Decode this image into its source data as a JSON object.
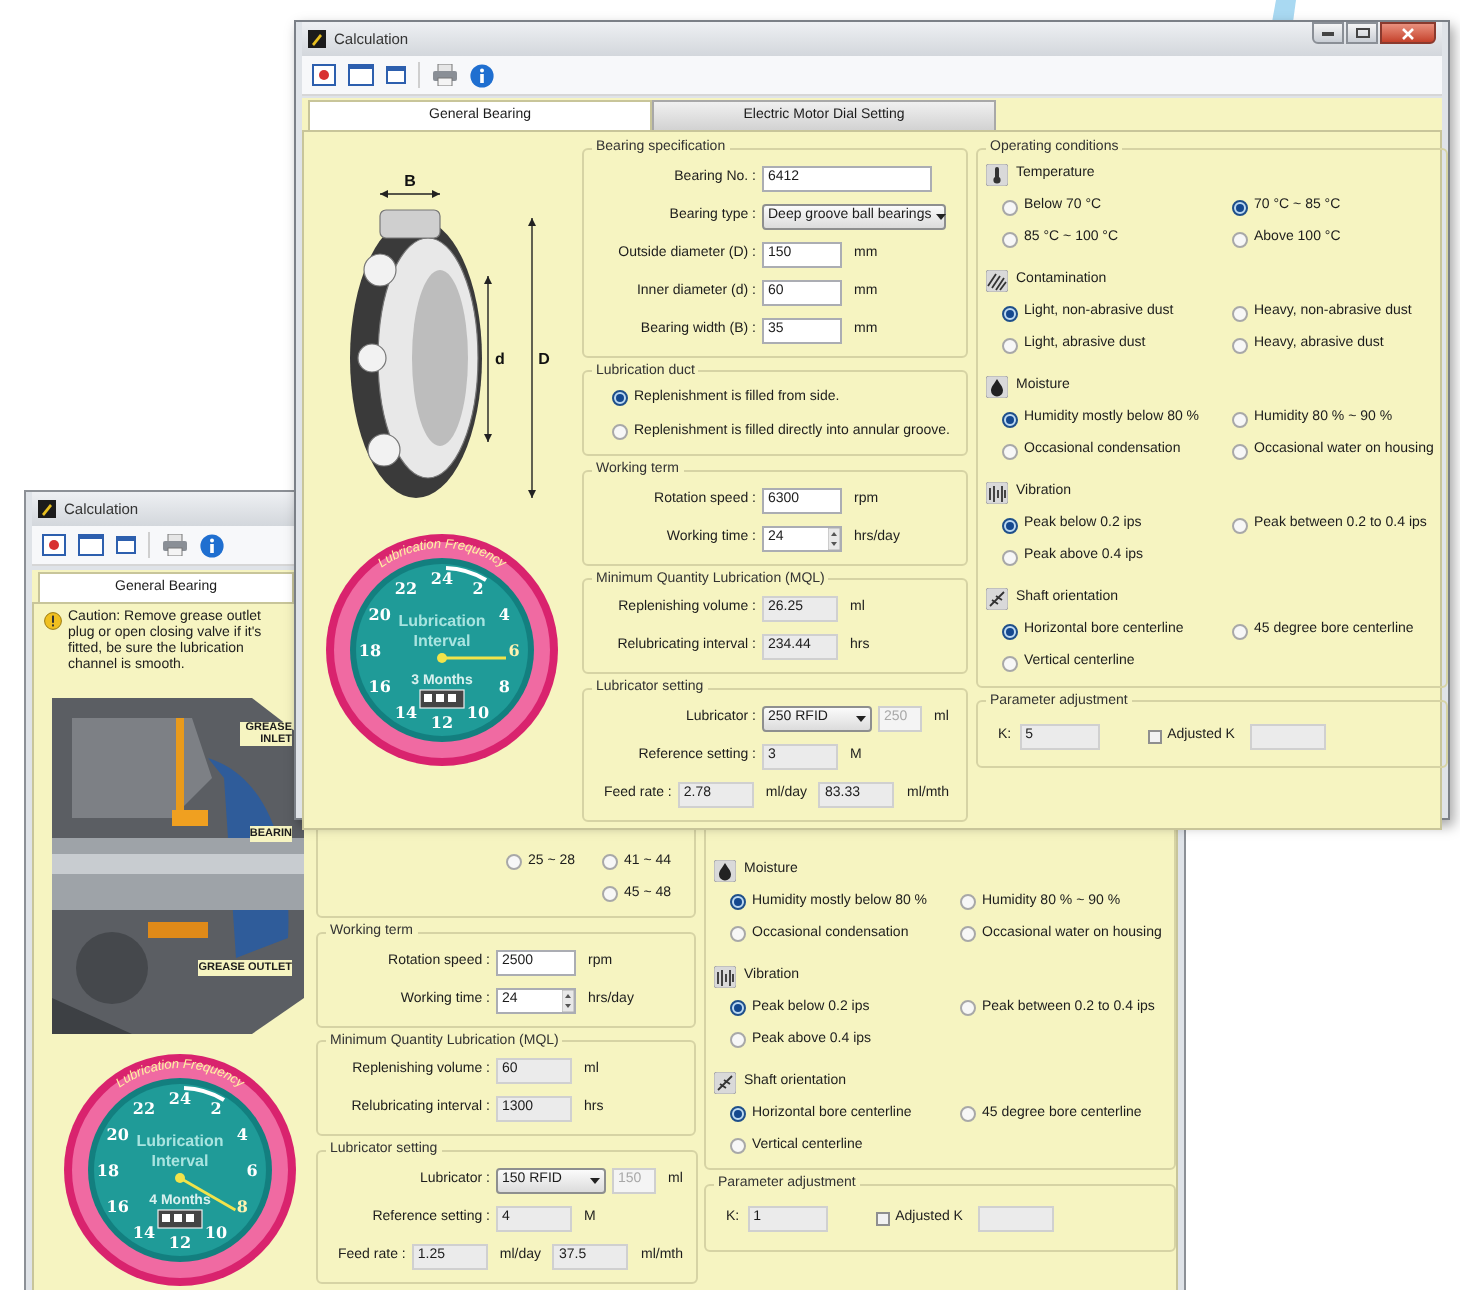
{
  "back_window": {
    "title": "Calculation",
    "tabs": [
      {
        "label": "General Bearing",
        "selected": true
      }
    ],
    "caution": "Caution: Remove grease outlet plug or open closing valve if it's fitted, be sure the lubrication channel is smooth.",
    "picture_labels": [
      "GREASE INLET",
      "BEARIN",
      "GREASE OUTLET"
    ],
    "gauge": {
      "title": "Lubrication Frequency",
      "numbers": [
        {
          "label": "2",
          "selected": false
        },
        {
          "label": "4",
          "selected": false
        },
        {
          "label": "6",
          "selected": false
        },
        {
          "label": "8",
          "selected": true
        },
        {
          "label": "10",
          "selected": false
        },
        {
          "label": "12",
          "selected": false
        },
        {
          "label": "14",
          "selected": false
        },
        {
          "label": "16",
          "selected": false
        },
        {
          "label": "18",
          "selected": false
        },
        {
          "label": "20",
          "selected": false
        },
        {
          "label": "22",
          "selected": false
        },
        {
          "label": "24",
          "selected": false
        }
      ],
      "label_lines": [
        "Lubrication",
        "Interval"
      ],
      "period": "4 Months"
    },
    "range_options": [
      [
        {
          "label": "25 ~ 28",
          "selected": false
        },
        {
          "label": "41 ~ 44",
          "selected": false
        }
      ],
      [
        {
          "label": "45 ~ 48",
          "selected": false
        }
      ]
    ],
    "groups": [
      {
        "title": "Working term",
        "rows": [
          {
            "label": "Rotation speed :",
            "parts": [
              {
                "kind": "number",
                "value": "2500"
              },
              {
                "kind": "unit",
                "value": "rpm"
              }
            ]
          },
          {
            "label": "Working time :",
            "parts": [
              {
                "kind": "spin",
                "value": "24"
              },
              {
                "kind": "unit",
                "value": "hrs/day"
              }
            ]
          }
        ]
      },
      {
        "title": "Minimum Quantity Lubrication (MQL)",
        "rows": [
          {
            "label": "Replenishing volume :",
            "parts": [
              {
                "kind": "readonly",
                "value": "60"
              },
              {
                "kind": "unit",
                "value": "ml"
              }
            ]
          },
          {
            "label": "Relubricating interval :",
            "parts": [
              {
                "kind": "readonly",
                "value": "1300"
              },
              {
                "kind": "unit",
                "value": "hrs"
              }
            ]
          }
        ]
      },
      {
        "title": "Lubricator setting",
        "rows": [
          {
            "label": "Lubricator :",
            "parts": [
              {
                "kind": "select",
                "value": "150 RFID"
              },
              {
                "kind": "disabled",
                "value": "150"
              },
              {
                "kind": "unit",
                "value": "ml"
              }
            ]
          },
          {
            "label": "Reference setting :",
            "parts": [
              {
                "kind": "readonly",
                "value": "4"
              },
              {
                "kind": "unit",
                "value": "M"
              }
            ]
          },
          {
            "label": "Feed rate :",
            "parts": [
              {
                "kind": "readonly",
                "value": "1.25"
              },
              {
                "kind": "unit",
                "value": "ml/day"
              },
              {
                "kind": "readonly",
                "value": "37.5"
              },
              {
                "kind": "unit",
                "value": "ml/mth"
              }
            ]
          }
        ]
      }
    ],
    "operating_conditions": {
      "categories": [
        {
          "kind": "moisture",
          "name": "Moisture",
          "options": [
            {
              "label": "Humidity mostly below 80 %",
              "selected": true
            },
            {
              "label": "Humidity 80 % ~ 90 %",
              "selected": false
            },
            {
              "label": "Occasional condensation",
              "selected": false
            },
            {
              "label": "Occasional water on housing",
              "selected": false
            }
          ]
        },
        {
          "kind": "vibration",
          "name": "Vibration",
          "options": [
            {
              "label": "Peak below 0.2 ips",
              "selected": true
            },
            {
              "label": "Peak between 0.2 to 0.4 ips",
              "selected": false
            },
            {
              "label": "Peak above 0.4 ips",
              "selected": false
            }
          ]
        },
        {
          "kind": "shaft",
          "name": "Shaft orientation",
          "options": [
            {
              "label": "Horizontal bore centerline",
              "selected": true
            },
            {
              "label": "45 degree bore centerline",
              "selected": false
            },
            {
              "label": "Vertical centerline",
              "selected": false
            }
          ]
        }
      ]
    },
    "parameter_adjustment": {
      "title": "Parameter adjustment",
      "k_label": "K:",
      "k_value": "1",
      "adjusted_label": "Adjusted K",
      "adjusted_checked": false
    }
  },
  "front_window": {
    "title": "Calculation",
    "tabs": [
      {
        "label": "General Bearing",
        "selected": true
      },
      {
        "label": "Electric Motor Dial Setting",
        "selected": false
      }
    ],
    "bearing_labels": [
      "B",
      "d",
      "D"
    ],
    "gauge": {
      "title": "Lubrication Frequency",
      "numbers": [
        {
          "label": "2",
          "selected": false
        },
        {
          "label": "4",
          "selected": false
        },
        {
          "label": "6",
          "selected": true
        },
        {
          "label": "8",
          "selected": false
        },
        {
          "label": "10",
          "selected": false
        },
        {
          "label": "12",
          "selected": false
        },
        {
          "label": "14",
          "selected": false
        },
        {
          "label": "16",
          "selected": false
        },
        {
          "label": "18",
          "selected": false
        },
        {
          "label": "20",
          "selected": false
        },
        {
          "label": "22",
          "selected": false
        },
        {
          "label": "24",
          "selected": false
        }
      ],
      "label_lines": [
        "Lubrication",
        "Interval"
      ],
      "period": "3 Months"
    },
    "groups": [
      {
        "title": "Bearing specification",
        "rows": [
          {
            "label": "Bearing No. :",
            "parts": [
              {
                "kind": "text",
                "value": "6412"
              }
            ]
          },
          {
            "label": "Bearing type :",
            "parts": [
              {
                "kind": "select",
                "value": "Deep groove ball bearings"
              }
            ]
          },
          {
            "label": "Outside diameter (D) :",
            "parts": [
              {
                "kind": "number",
                "value": "150"
              },
              {
                "kind": "unit",
                "value": "mm"
              }
            ]
          },
          {
            "label": "Inner diameter (d) :",
            "parts": [
              {
                "kind": "number",
                "value": "60"
              },
              {
                "kind": "unit",
                "value": "mm"
              }
            ]
          },
          {
            "label": "Bearing width (B) :",
            "parts": [
              {
                "kind": "number",
                "value": "35"
              },
              {
                "kind": "unit",
                "value": "mm"
              }
            ]
          }
        ]
      },
      {
        "title": "Lubrication duct",
        "options": [
          {
            "label": "Replenishment is filled from side.",
            "selected": true
          },
          {
            "label": "Replenishment is filled directly into annular groove.",
            "selected": false
          }
        ]
      },
      {
        "title": "Working term",
        "rows": [
          {
            "label": "Rotation speed :",
            "parts": [
              {
                "kind": "number",
                "value": "6300"
              },
              {
                "kind": "unit",
                "value": "rpm"
              }
            ]
          },
          {
            "label": "Working time :",
            "parts": [
              {
                "kind": "spin",
                "value": "24"
              },
              {
                "kind": "unit",
                "value": "hrs/day"
              }
            ]
          }
        ]
      },
      {
        "title": "Minimum Quantity Lubrication (MQL)",
        "rows": [
          {
            "label": "Replenishing volume :",
            "parts": [
              {
                "kind": "readonly",
                "value": "26.25"
              },
              {
                "kind": "unit",
                "value": "ml"
              }
            ]
          },
          {
            "label": "Relubricating interval :",
            "parts": [
              {
                "kind": "readonly",
                "value": "234.44"
              },
              {
                "kind": "unit",
                "value": "hrs"
              }
            ]
          }
        ]
      },
      {
        "title": "Lubricator setting",
        "rows": [
          {
            "label": "Lubricator :",
            "parts": [
              {
                "kind": "select",
                "value": "250 RFID"
              },
              {
                "kind": "disabled",
                "value": "250"
              },
              {
                "kind": "unit",
                "value": "ml"
              }
            ]
          },
          {
            "label": "Reference setting :",
            "parts": [
              {
                "kind": "readonly",
                "value": "3"
              },
              {
                "kind": "unit",
                "value": "M"
              }
            ]
          },
          {
            "label": "Feed rate :",
            "parts": [
              {
                "kind": "readonly",
                "value": "2.78"
              },
              {
                "kind": "unit",
                "value": "ml/day"
              },
              {
                "kind": "readonly",
                "value": "83.33"
              },
              {
                "kind": "unit",
                "value": "ml/mth"
              }
            ]
          }
        ]
      }
    ],
    "operating_conditions": {
      "title": "Operating conditions",
      "categories": [
        {
          "kind": "temperature",
          "name": "Temperature",
          "options": [
            {
              "label": "Below 70 °C",
              "selected": false
            },
            {
              "label": "70 °C ~ 85 °C",
              "selected": true
            },
            {
              "label": "85 °C ~ 100 °C",
              "selected": false
            },
            {
              "label": "Above 100 °C",
              "selected": false
            }
          ]
        },
        {
          "kind": "contamination",
          "name": "Contamination",
          "options": [
            {
              "label": "Light, non-abrasive dust",
              "selected": true
            },
            {
              "label": "Heavy, non-abrasive dust",
              "selected": false
            },
            {
              "label": "Light, abrasive dust",
              "selected": false
            },
            {
              "label": "Heavy, abrasive dust",
              "selected": false
            }
          ]
        },
        {
          "kind": "moisture",
          "name": "Moisture",
          "options": [
            {
              "label": "Humidity mostly below 80 %",
              "selected": true
            },
            {
              "label": "Humidity 80 % ~ 90 %",
              "selected": false
            },
            {
              "label": "Occasional condensation",
              "selected": false
            },
            {
              "label": "Occasional water on housing",
              "selected": false
            }
          ]
        },
        {
          "kind": "vibration",
          "name": "Vibration",
          "options": [
            {
              "label": "Peak below 0.2 ips",
              "selected": true
            },
            {
              "label": "Peak between 0.2 to 0.4 ips",
              "selected": false
            },
            {
              "label": "Peak above 0.4 ips",
              "selected": false
            }
          ]
        },
        {
          "kind": "shaft",
          "name": "Shaft orientation",
          "options": [
            {
              "label": "Horizontal bore centerline",
              "selected": true
            },
            {
              "label": "45 degree bore centerline",
              "selected": false
            },
            {
              "label": "Vertical centerline",
              "selected": false
            }
          ]
        }
      ]
    },
    "parameter_adjustment": {
      "title": "Parameter adjustment",
      "k_label": "K:",
      "k_value": "5",
      "adjusted_label": "Adjusted K",
      "adjusted_checked": false
    }
  }
}
